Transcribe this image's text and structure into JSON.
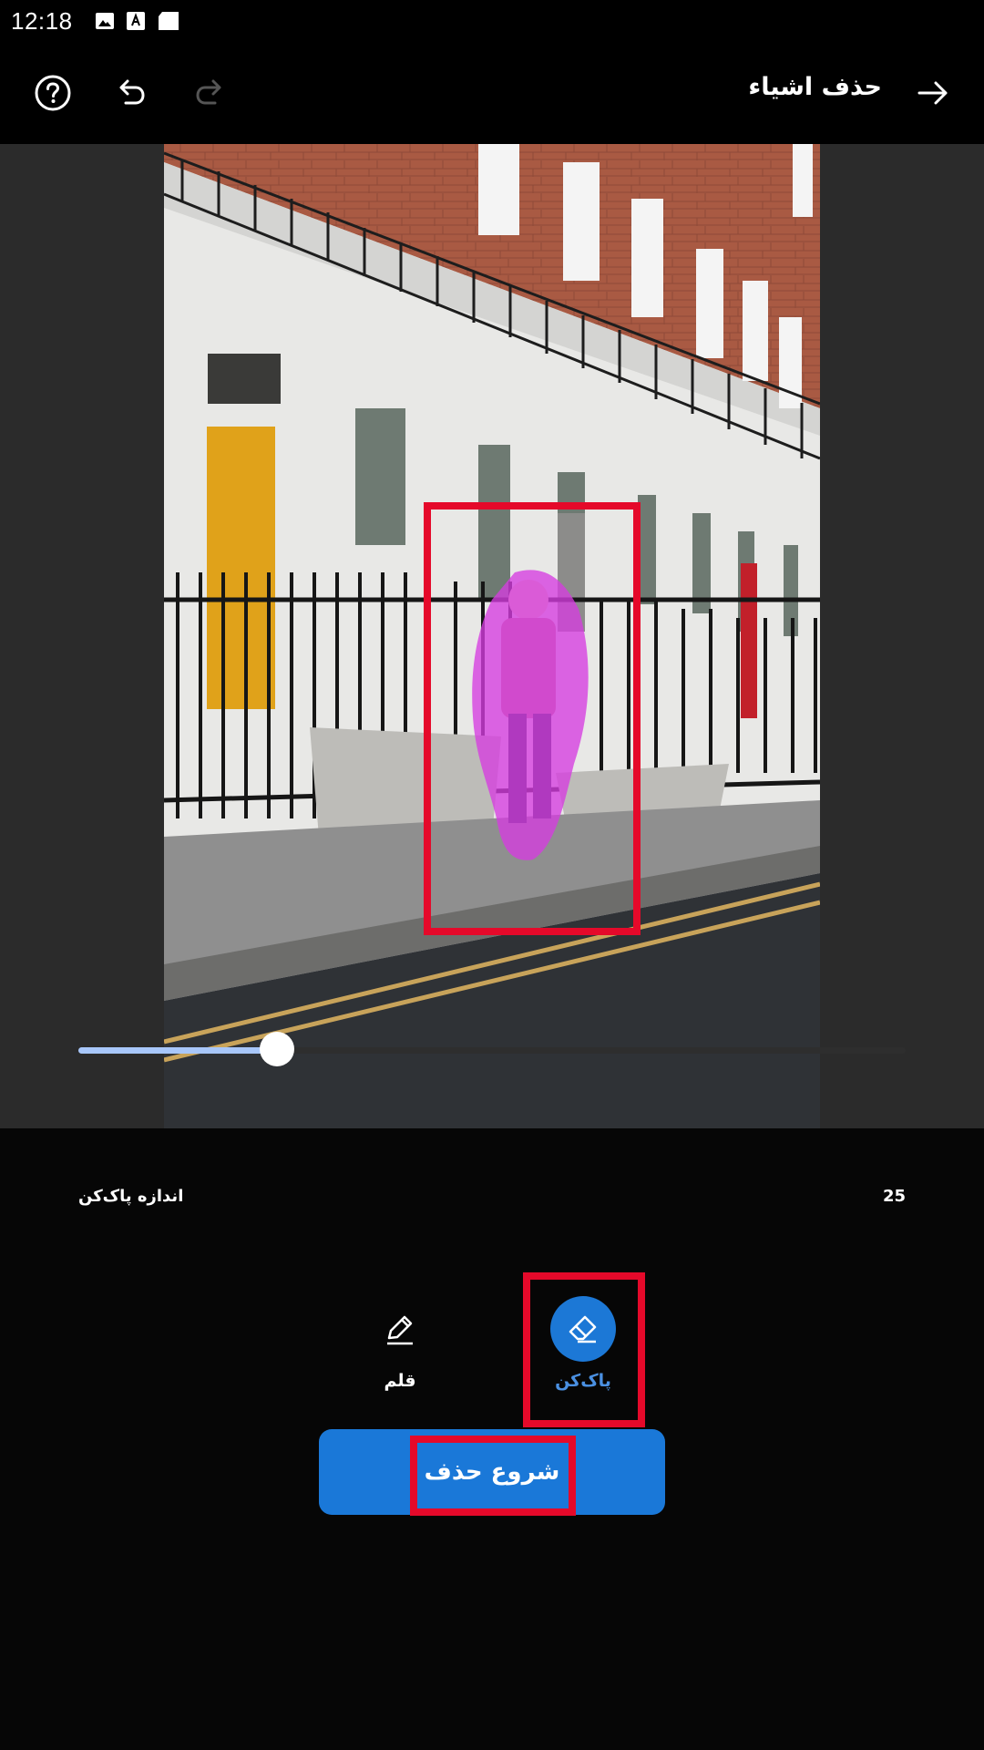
{
  "status_bar": {
    "time": "12:18",
    "icons": [
      "image-icon",
      "font-download-icon",
      "sd-card-icon"
    ]
  },
  "app_bar": {
    "title": "حذف اشیاء",
    "help_icon": "help-circle-icon",
    "undo_icon": "undo-icon",
    "redo_icon": "redo-icon",
    "next_icon": "arrow-right-icon"
  },
  "brush": {
    "label": "اندازه پاک‌کن",
    "value": "25",
    "slider_fraction": 0.24
  },
  "tools": {
    "pen_label": "قلم",
    "eraser_label": "پاک‌کن",
    "selected": "eraser"
  },
  "start_button_label": "شروع حذف",
  "colors": {
    "accent": "#1a78d8",
    "selection_mask": "#d63ce0",
    "highlight": "#e5092a"
  }
}
